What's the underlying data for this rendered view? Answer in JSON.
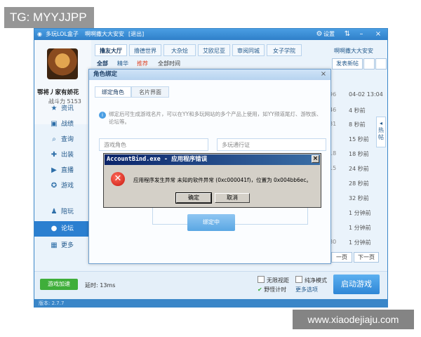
{
  "watermarks": {
    "top_left": "TG: MYYJJPP",
    "bottom_right": "www.xiaodejiaju.com"
  },
  "titlebar": {
    "app_name": "多玩LOL盒子",
    "user": "啊啊撒大大安安",
    "logout": "[退出]",
    "settings_label": "设置",
    "icons": [
      "gear-icon",
      "skin-icon",
      "minimize-icon",
      "close-icon"
    ]
  },
  "profile": {
    "name": "鄂将丿家有娇花",
    "score_label": "战斗力 5153"
  },
  "sidebar": {
    "items": [
      {
        "label": "资讯",
        "icon": "star-icon",
        "glyph": "★"
      },
      {
        "label": "战绩",
        "icon": "chart-icon",
        "glyph": "▣"
      },
      {
        "label": "查询",
        "icon": "search-icon",
        "glyph": "⌕"
      },
      {
        "label": "出装",
        "icon": "equip-icon",
        "glyph": "✚"
      },
      {
        "label": "直播",
        "icon": "play-icon",
        "glyph": "▶"
      },
      {
        "label": "游戏",
        "icon": "gamepad-icon",
        "glyph": "✪"
      },
      {
        "label": "陪玩",
        "icon": "people-icon",
        "glyph": "♟"
      },
      {
        "label": "论坛",
        "icon": "chat-icon",
        "glyph": "●"
      },
      {
        "label": "更多",
        "icon": "grid-icon",
        "glyph": "▦"
      }
    ],
    "active_index": 7
  },
  "tabs": [
    "撸友大厅",
    "撸德世界",
    "大杂烩",
    "艾欧尼亚",
    "审阅同城",
    "女子学院"
  ],
  "user_right": "啊啊撒大大安安",
  "subtabs": {
    "all": "全部",
    "best": "精华",
    "recommend": "推荐",
    "all_time": "全部时间"
  },
  "post_button": "发表新帖",
  "list_rows": [
    {
      "n": "96",
      "t": "04-02 13:04"
    },
    {
      "n": "46",
      "t": "4 秒前"
    },
    {
      "n": "81",
      "t": "8 秒前"
    },
    {
      "n": "",
      "t": "15 秒前"
    },
    {
      "n": "18",
      "t": "18 秒前"
    },
    {
      "n": "15",
      "t": "24 秒前"
    },
    {
      "n": "",
      "t": "28 秒前"
    },
    {
      "n": "",
      "t": "32 秒前"
    },
    {
      "n": "",
      "t": "1 分钟前"
    },
    {
      "n": "",
      "t": "1 分钟前"
    },
    {
      "n": "80",
      "t": "1 分钟前"
    }
  ],
  "hot_tab": "热帖",
  "pager": {
    "prev": "一页",
    "next": "下一页"
  },
  "bottombar": {
    "accel": "游戏加速",
    "delay": "延时: 13ms",
    "no_border": "无限视距",
    "pure_mode": "纯净模式",
    "wild_timer": "野怪计时",
    "more_options": "更多选项",
    "start_button": "启动游戏"
  },
  "statusbar": "版本: 2.7.7",
  "bind_dialog": {
    "title": "角色绑定",
    "tab_bind": "绑定角色",
    "tab_card": "名片界面",
    "hint": "绑定后可生成游戏名片，可以在YY和多玩网站的多个产品上使用，如YY频道尾灯、游牧族、论坛等。",
    "field_role": "游戏角色",
    "field_verify": "多玩通行证",
    "bind_button": "绑定中"
  },
  "error_dialog": {
    "title": "AccountBind.exe - 应用程序错误",
    "message": "应用程序发生异常 未知的软件异常 (0xc000041f)，位置为 0x004bb6ec。",
    "ok": "确定",
    "cancel": "取消"
  },
  "colors": {
    "accent": "#2b7fd0",
    "title_blue": "#0a246a",
    "start_green": "#3fae3a",
    "error_red": "#c81810"
  }
}
